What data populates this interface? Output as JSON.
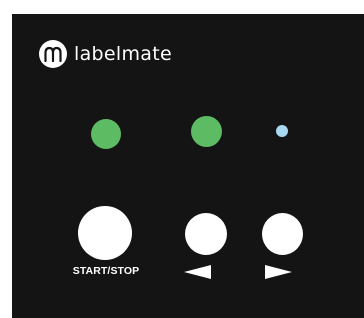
{
  "brand": {
    "name": "labelmate",
    "logo_icon": "m-letter-logo-icon"
  },
  "leds": [
    {
      "name": "led-1",
      "color": "#5dbb63",
      "state": "on"
    },
    {
      "name": "led-2",
      "color": "#5dbb63",
      "state": "on"
    },
    {
      "name": "led-3",
      "color": "#a9d9f2",
      "state": "on"
    }
  ],
  "controls": {
    "start_stop_label": "START/STOP",
    "previous_icon": "left-triangle-icon",
    "next_icon": "right-triangle-icon"
  },
  "colors": {
    "panel": "#141414",
    "foreground": "#ffffff",
    "led_green": "#5dbb63",
    "led_blue": "#a9d9f2"
  }
}
